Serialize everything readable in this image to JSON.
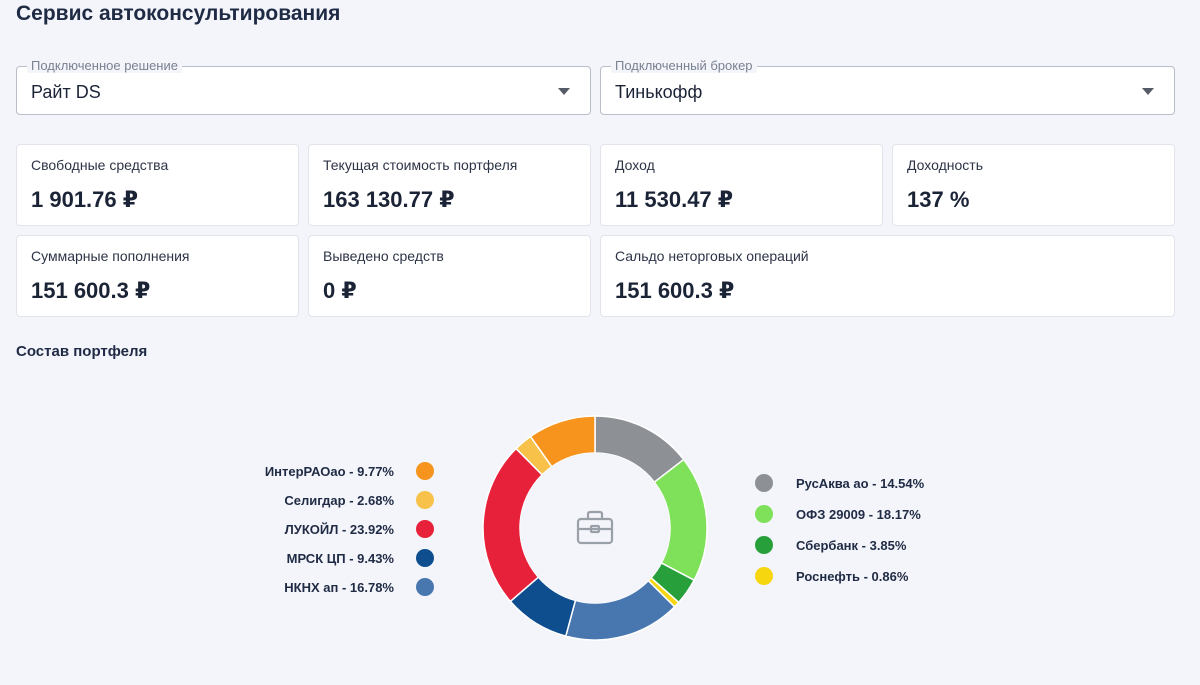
{
  "page": {
    "title": "Сервис автоконсультирования"
  },
  "selects": {
    "solution": {
      "label": "Подключенное решение",
      "value": "Райт DS"
    },
    "broker": {
      "label": "Подключенный брокер",
      "value": "Тинькофф"
    }
  },
  "cards": {
    "free_funds": {
      "label": "Свободные средства",
      "value": "1 901.76 ₽"
    },
    "portfolio_value": {
      "label": "Текущая стоимость портфеля",
      "value": "163 130.77 ₽"
    },
    "income": {
      "label": "Доход",
      "value": "11 530.47 ₽"
    },
    "yield": {
      "label": "Доходность",
      "value": "137 %"
    },
    "total_deposits": {
      "label": "Суммарные пополнения",
      "value": "151 600.3 ₽"
    },
    "withdrawn": {
      "label": "Выведено средств",
      "value": "0 ₽"
    },
    "non_trading_balance": {
      "label": "Сальдо неторговых операций",
      "value": "151 600.3 ₽"
    }
  },
  "portfolio": {
    "title": "Состав портфеля",
    "center_icon": "briefcase-icon",
    "legend_left": [
      {
        "text": "ИнтерРАОао - 9.77%",
        "color": "#f7941d"
      },
      {
        "text": "Селигдар - 2.68%",
        "color": "#f8c24a"
      },
      {
        "text": "ЛУКОЙЛ - 23.92%",
        "color": "#e8213b"
      },
      {
        "text": "МРСК ЦП - 9.43%",
        "color": "#0e4e8f"
      },
      {
        "text": "НКНХ ап - 16.78%",
        "color": "#4877b0"
      }
    ],
    "legend_right": [
      {
        "text": "РусАква ао - 14.54%",
        "color": "#8d9196"
      },
      {
        "text": "ОФЗ 29009 - 18.17%",
        "color": "#7ee159"
      },
      {
        "text": "Сбербанк - 3.85%",
        "color": "#27a03b"
      },
      {
        "text": "Роснефть - 0.86%",
        "color": "#f5d60f"
      }
    ]
  },
  "chart_data": {
    "type": "pie",
    "categories": [
      "РусАква ао",
      "ОФЗ 29009",
      "Сбербанк",
      "Роснефть",
      "НКНХ ап",
      "МРСК ЦП",
      "ЛУКОЙЛ",
      "Селигдар",
      "ИнтерРАОао"
    ],
    "values": [
      14.54,
      18.17,
      3.85,
      0.86,
      16.78,
      9.43,
      23.92,
      2.68,
      9.77
    ],
    "colors": [
      "#8d9196",
      "#7ee159",
      "#27a03b",
      "#f5d60f",
      "#4877b0",
      "#0e4e8f",
      "#e8213b",
      "#f8c24a",
      "#f7941d"
    ],
    "donut": true
  }
}
